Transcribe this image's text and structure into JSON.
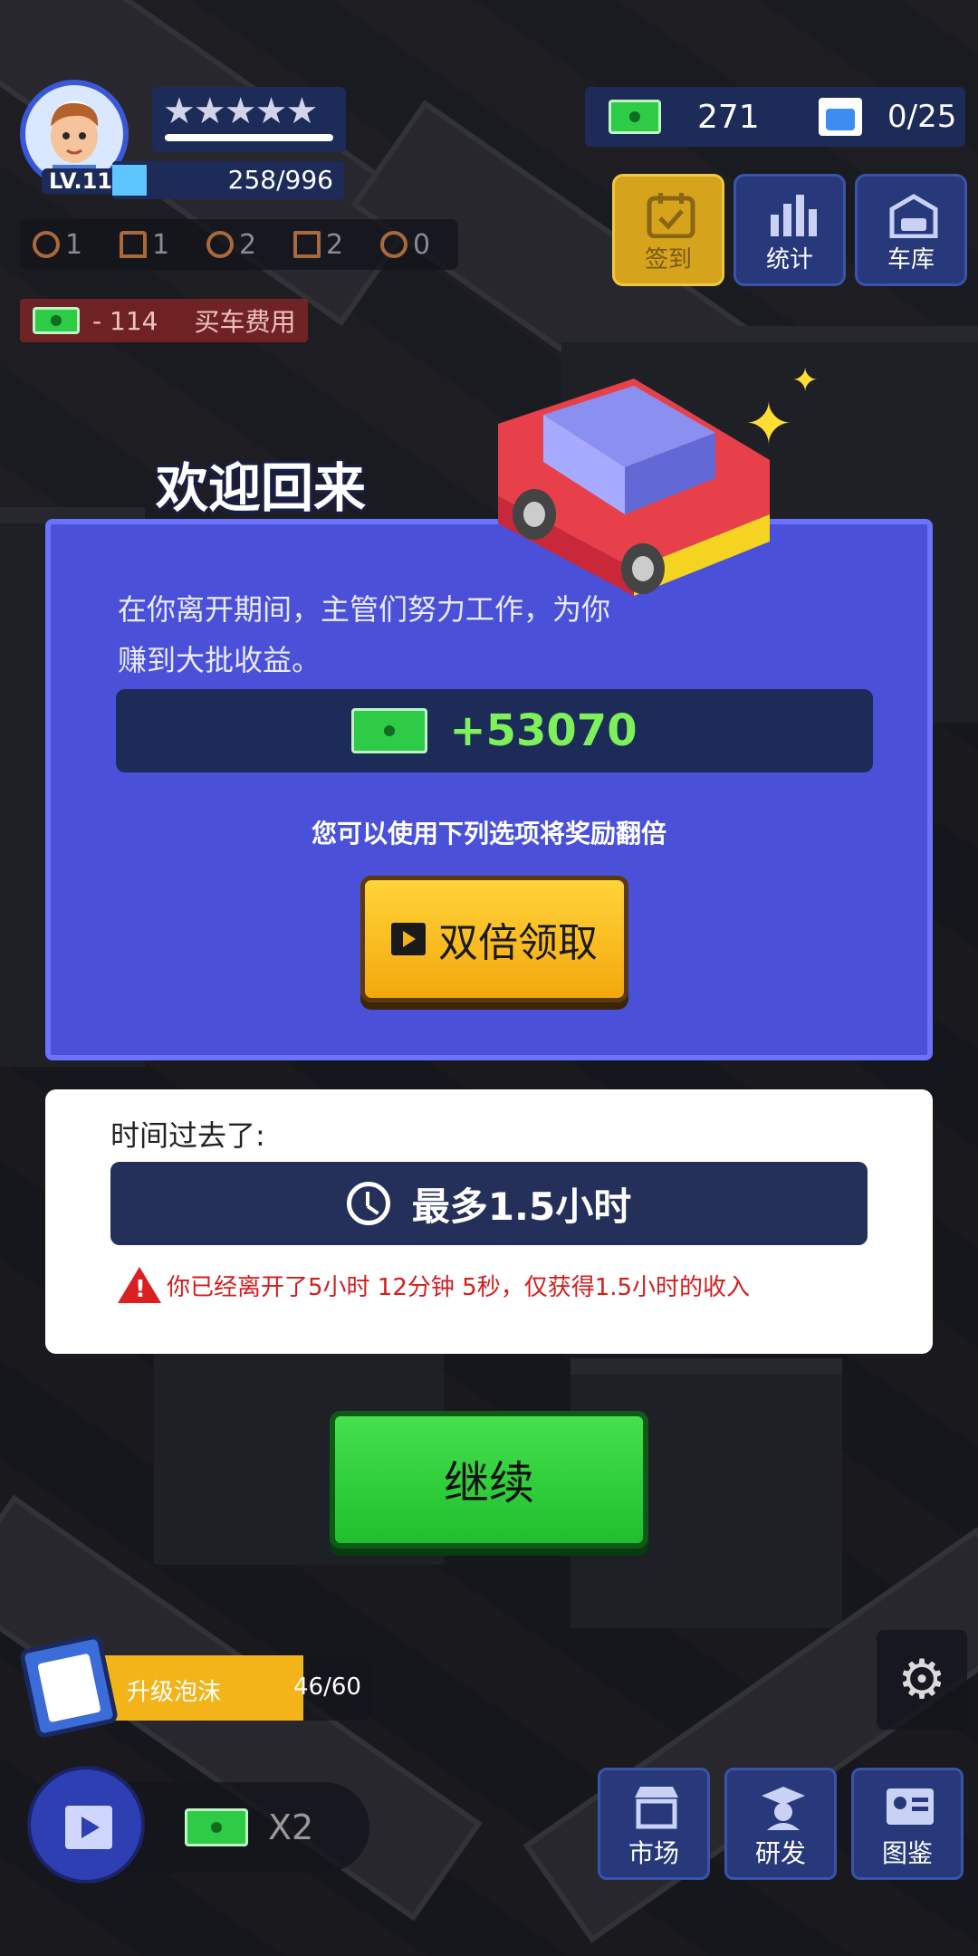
{
  "hud": {
    "level": "LV.11",
    "xp": "258/996",
    "xp_fraction": 0.15,
    "stars": "★★★★★",
    "chips": [
      {
        "icon": "tire-icon",
        "value": "1"
      },
      {
        "icon": "cone-icon",
        "value": "1"
      },
      {
        "icon": "speedometer-icon",
        "value": "2"
      },
      {
        "icon": "blueprint-icon",
        "value": "2"
      },
      {
        "icon": "location-pin-icon",
        "value": "0"
      }
    ],
    "cost_value": "- 114",
    "cost_label": "买车费用",
    "money": "271",
    "garage_count": "0/25"
  },
  "top_buttons": [
    {
      "label": "签到",
      "icon": "calendar-check-icon"
    },
    {
      "label": "统计",
      "icon": "bar-chart-icon"
    },
    {
      "label": "车库",
      "icon": "garage-icon"
    }
  ],
  "dialog": {
    "title": "欢迎回来",
    "description": "在你离开期间，主管们努力工作，为你赚到大批收益。",
    "earnings": "+53070",
    "double_hint": "您可以使用下列选项将奖励翻倍",
    "double_button": "双倍领取"
  },
  "time": {
    "label": "时间过去了:",
    "value": "最多1.5小时",
    "warning": "你已经离开了5小时 12分钟 5秒，仅获得1.5小时的收入"
  },
  "continue_button": "继续",
  "upgrade": {
    "label": "升级泡沫",
    "count": "46/60",
    "fraction": 0.767
  },
  "ad_multiplier": "X2",
  "bottom_buttons": [
    {
      "label": "市场",
      "icon": "market-icon"
    },
    {
      "label": "研发",
      "icon": "research-icon"
    },
    {
      "label": "图鉴",
      "icon": "id-card-icon"
    }
  ],
  "colors": {
    "panel": "#4a51d8",
    "earnings": "#7df05a",
    "double_button": "#f3a80c",
    "continue_button": "#1fbf2d",
    "warning": "#d31d1d"
  }
}
